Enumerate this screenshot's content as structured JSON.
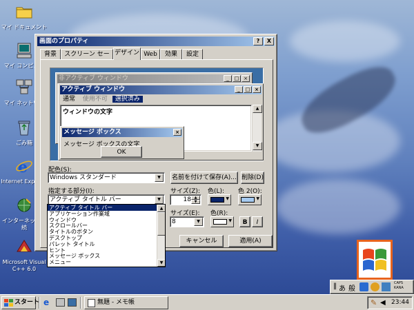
{
  "desktop": {
    "icons": [
      {
        "name": "my-documents-icon",
        "label": "マイ ドキュメント"
      },
      {
        "name": "my-computer-icon",
        "label": "マイ コンピュー"
      },
      {
        "name": "network-icon",
        "label": "マイ ネットワー"
      },
      {
        "name": "recycle-bin-icon",
        "label": "ごみ箱"
      },
      {
        "name": "internet-explorer-icon",
        "label": "Internet Explorer"
      },
      {
        "name": "internet-connect-icon",
        "label": "インターネット接続"
      },
      {
        "name": "visual-cpp-icon",
        "label": "Microsoft Visual C++ 6.0"
      }
    ]
  },
  "dialog": {
    "title": "画面のプロパティ",
    "help_btn": "?",
    "close_btn": "X",
    "tabs": [
      "背景",
      "スクリーン セーバー",
      "デザイン",
      "Web",
      "効果",
      "設定"
    ],
    "active_tab": "デザイン",
    "preview": {
      "inactive_title": "非アクティブ ウィンドウ",
      "active_title": "アクティブ ウィンドウ",
      "menu_normal": "通常",
      "menu_disabled": "使用不可",
      "menu_selected": "選択済み",
      "window_text": "ウィンドウの文字",
      "msgbox_title": "メッセージ ボックス",
      "msgbox_text": "メッセージ ボックスの文字",
      "ok": "OK",
      "min_glyph": "_",
      "max_glyph": "□",
      "close_glyph": "×"
    },
    "scheme_label": "配色(S):",
    "scheme_value": "Windows スタンダード",
    "save_as_btn": "名前を付けて保存(A)...",
    "delete_btn": "削除(D)",
    "item_label": "指定する部分(I):",
    "item_value": "アクティブ タイトル バー",
    "size_label_1": "サイズ(Z):",
    "size_value_1": "18",
    "color1_label": "色(L):",
    "color2_label": "色 2(O):",
    "size_label_2": "サイズ(E):",
    "size_value_2": "8",
    "color_label_3": "色(R):",
    "bold_btn": "B",
    "italic_btn": "I",
    "cancel_btn": "キャンセル",
    "apply_btn": "適用(A)",
    "item_options": [
      "アクティブ タイトル バー",
      "アプリケーション作業域",
      "ウィンドウ",
      "スクロールバー",
      "タイトルのボタン",
      "デスクトップ",
      "パレット タイトル",
      "ヒント",
      "メッセージ ボックス",
      "メニュー"
    ],
    "colors": {
      "color1": "#0a246a",
      "color2": "#a6caf0",
      "font_color": "#ffffff"
    }
  },
  "taskbar": {
    "start": "スタート",
    "task": "無題 - メモ帳",
    "clock": "23:44"
  },
  "ime": {
    "mode": "あ",
    "kanji": "般",
    "caps": "CAPS",
    "kana": "KANA"
  },
  "colors": {
    "title_active_start": "#0a246a",
    "title_active_end": "#a6caf0",
    "title_inactive_start": "#808080",
    "title_inactive_end": "#c0c0c0",
    "face": "#d4d0c8",
    "selection": "#0a246a"
  }
}
